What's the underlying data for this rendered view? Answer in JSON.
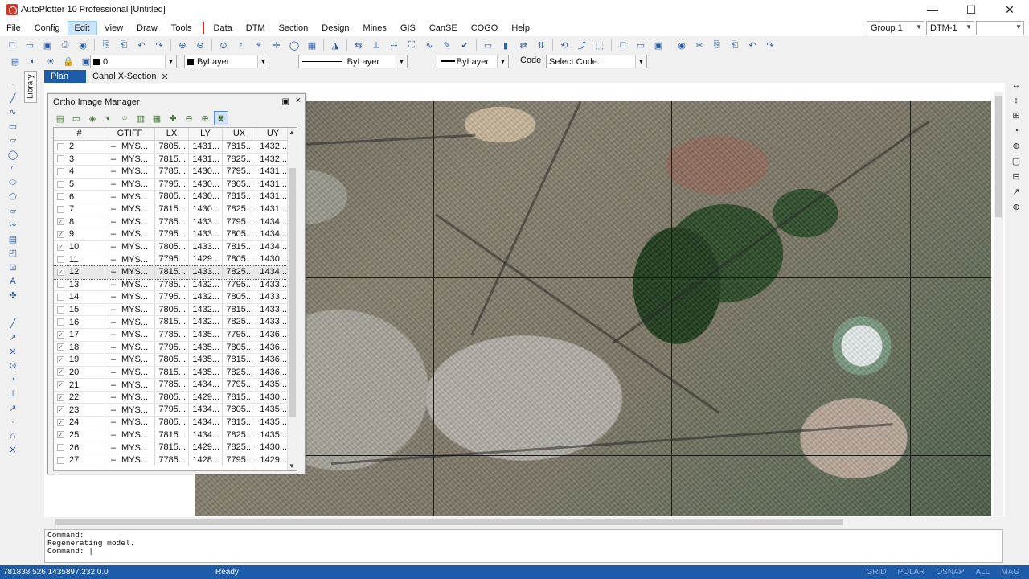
{
  "window": {
    "title": "AutoPlotter 10 Professional [Untitled]",
    "minimize": "—",
    "maximize": "☐",
    "close": "✕"
  },
  "menu": [
    "File",
    "Config",
    "Edit",
    "View",
    "Draw",
    "Tools",
    "Data",
    "DTM",
    "Section",
    "Design",
    "Mines",
    "GIS",
    "CanSE",
    "COGO",
    "Help"
  ],
  "menu_active": "Edit",
  "group_combo": "Group 1",
  "dtm_combo": "DTM-1",
  "layer": {
    "value": "0",
    "color": "ByLayer",
    "linetype": "ByLayer",
    "lineweight": "ByLayer"
  },
  "code": {
    "label": "Code",
    "placeholder": "Select Code.."
  },
  "tabs": [
    {
      "label": "Plan",
      "active": true
    },
    {
      "label": "Canal X-Section",
      "active": false
    }
  ],
  "tab_close": "✕",
  "library_label": "Library",
  "panel": {
    "title": "Ortho Image Manager",
    "pin": "📌",
    "close": "×",
    "columns": [
      "#",
      "GTIFF",
      "LX",
      "LY",
      "UX",
      "UY"
    ],
    "rows": [
      {
        "n": "2",
        "checked": false,
        "g": "MYS...",
        "lx": "7805...",
        "ly": "1431...",
        "ux": "7815...",
        "uy": "1432..."
      },
      {
        "n": "3",
        "checked": false,
        "g": "MYS...",
        "lx": "7815...",
        "ly": "1431...",
        "ux": "7825...",
        "uy": "1432..."
      },
      {
        "n": "4",
        "checked": false,
        "g": "MYS...",
        "lx": "7785...",
        "ly": "1430...",
        "ux": "7795...",
        "uy": "1431..."
      },
      {
        "n": "5",
        "checked": false,
        "g": "MYS...",
        "lx": "7795...",
        "ly": "1430...",
        "ux": "7805...",
        "uy": "1431..."
      },
      {
        "n": "6",
        "checked": false,
        "g": "MYS...",
        "lx": "7805...",
        "ly": "1430...",
        "ux": "7815...",
        "uy": "1431..."
      },
      {
        "n": "7",
        "checked": false,
        "g": "MYS...",
        "lx": "7815...",
        "ly": "1430...",
        "ux": "7825...",
        "uy": "1431..."
      },
      {
        "n": "8",
        "checked": true,
        "g": "MYS...",
        "lx": "7785...",
        "ly": "1433...",
        "ux": "7795...",
        "uy": "1434..."
      },
      {
        "n": "9",
        "checked": true,
        "g": "MYS...",
        "lx": "7795...",
        "ly": "1433...",
        "ux": "7805...",
        "uy": "1434..."
      },
      {
        "n": "10",
        "checked": true,
        "g": "MYS...",
        "lx": "7805...",
        "ly": "1433...",
        "ux": "7815...",
        "uy": "1434..."
      },
      {
        "n": "11",
        "checked": false,
        "g": "MYS...",
        "lx": "7795...",
        "ly": "1429...",
        "ux": "7805...",
        "uy": "1430..."
      },
      {
        "n": "12",
        "checked": true,
        "g": "MYS...",
        "lx": "7815...",
        "ly": "1433...",
        "ux": "7825...",
        "uy": "1434...",
        "selected": true
      },
      {
        "n": "13",
        "checked": false,
        "g": "MYS...",
        "lx": "7785...",
        "ly": "1432...",
        "ux": "7795...",
        "uy": "1433..."
      },
      {
        "n": "14",
        "checked": false,
        "g": "MYS...",
        "lx": "7795...",
        "ly": "1432...",
        "ux": "7805...",
        "uy": "1433..."
      },
      {
        "n": "15",
        "checked": false,
        "g": "MYS...",
        "lx": "7805...",
        "ly": "1432...",
        "ux": "7815...",
        "uy": "1433..."
      },
      {
        "n": "16",
        "checked": false,
        "g": "MYS...",
        "lx": "7815...",
        "ly": "1432...",
        "ux": "7825...",
        "uy": "1433..."
      },
      {
        "n": "17",
        "checked": true,
        "g": "MYS...",
        "lx": "7785...",
        "ly": "1435...",
        "ux": "7795...",
        "uy": "1436..."
      },
      {
        "n": "18",
        "checked": true,
        "g": "MYS...",
        "lx": "7795...",
        "ly": "1435...",
        "ux": "7805...",
        "uy": "1436..."
      },
      {
        "n": "19",
        "checked": true,
        "g": "MYS...",
        "lx": "7805...",
        "ly": "1435...",
        "ux": "7815...",
        "uy": "1436..."
      },
      {
        "n": "20",
        "checked": true,
        "g": "MYS...",
        "lx": "7815...",
        "ly": "1435...",
        "ux": "7825...",
        "uy": "1436..."
      },
      {
        "n": "21",
        "checked": true,
        "g": "MYS...",
        "lx": "7785...",
        "ly": "1434...",
        "ux": "7795...",
        "uy": "1435..."
      },
      {
        "n": "22",
        "checked": true,
        "g": "MYS...",
        "lx": "7805...",
        "ly": "1429...",
        "ux": "7815...",
        "uy": "1430..."
      },
      {
        "n": "23",
        "checked": true,
        "g": "MYS...",
        "lx": "7795...",
        "ly": "1434...",
        "ux": "7805...",
        "uy": "1435..."
      },
      {
        "n": "24",
        "checked": true,
        "g": "MYS...",
        "lx": "7805...",
        "ly": "1434...",
        "ux": "7815...",
        "uy": "1435..."
      },
      {
        "n": "25",
        "checked": true,
        "g": "MYS...",
        "lx": "7815...",
        "ly": "1434...",
        "ux": "7825...",
        "uy": "1435..."
      },
      {
        "n": "26",
        "checked": false,
        "g": "MYS...",
        "lx": "7815...",
        "ly": "1429...",
        "ux": "7825...",
        "uy": "1430..."
      },
      {
        "n": "27",
        "checked": false,
        "g": "MYS...",
        "lx": "7785...",
        "ly": "1428...",
        "ux": "7795...",
        "uy": "1429..."
      }
    ]
  },
  "command_lines": [
    "Command:",
    " Regenerating model.",
    "Command:  |"
  ],
  "status": {
    "coords": "781838.526,1435897.232,0.0",
    "ready": "Ready",
    "modes": [
      "GRID",
      "POLAR",
      "OSNAP",
      "ALL",
      "MAG"
    ]
  },
  "colors": {
    "accent": "#1e5ba8",
    "menu_separator": "#e0241b",
    "selected_tab": "#1e5ba8"
  }
}
